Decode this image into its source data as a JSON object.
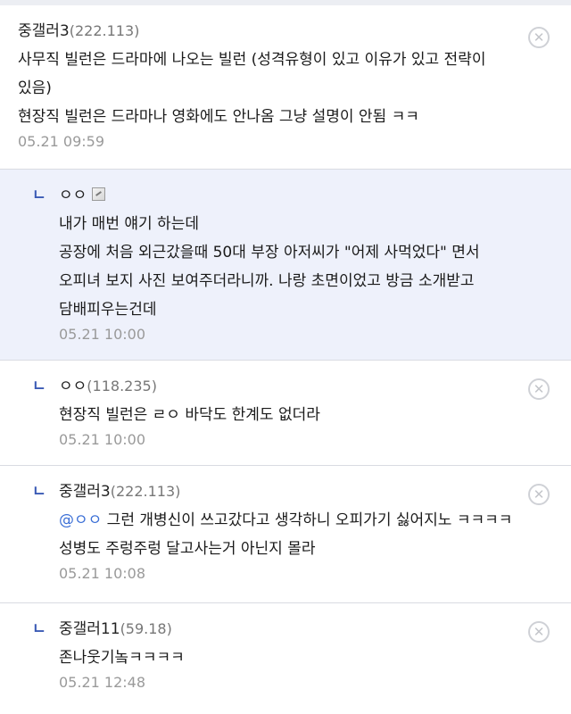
{
  "comments": [
    {
      "nick": "중갤러3",
      "ip": "(222.113)",
      "lines": [
        "사무직 빌런은 드라마에 나오는 빌런 (성격유형이 있고 이유가 있고 전략이 있음)",
        "현장직 빌런은 드라마나 영화에도 안나옴 그냥 설명이 안됨 ㅋㅋ"
      ],
      "date": "05.21 09:59"
    },
    {
      "reply_mark": "ㄴ",
      "nick": "ㅇㅇ",
      "lines": [
        "내가 매번 얘기 하는데",
        "공장에 처음 외근갔을때 50대 부장 아저씨가 \"어제 사먹었다\" 면서 오피녀 보지 사진 보여주더라니까. 나랑 초면이었고 방금 소개받고 담배피우는건데"
      ],
      "date": "05.21 10:00"
    },
    {
      "reply_mark": "ㄴ",
      "nick": "ㅇㅇ",
      "ip": "(118.235)",
      "text": "현장직 빌런은 ㄹㅇ 바닥도 한계도 없더라",
      "date": "05.21 10:00"
    },
    {
      "reply_mark": "ㄴ",
      "nick": "중갤러3",
      "ip": "(222.113)",
      "mention": "@ㅇㅇ",
      "text": " 그런 개병신이 쓰고갔다고 생각하니 오피가기 싫어지노 ㅋㅋㅋㅋ 성병도 주렁주렁 달고사는거 아닌지 몰라",
      "date": "05.21 10:08"
    },
    {
      "reply_mark": "ㄴ",
      "nick": "중갤러11",
      "ip": "(59.18)",
      "text": "존나웃기놐ㅋㅋㅋㅋ",
      "date": "05.21 12:48"
    }
  ],
  "close_glyph": "✕",
  "icons": {
    "close": "close-circle-icon",
    "memo": "memo-icon"
  }
}
